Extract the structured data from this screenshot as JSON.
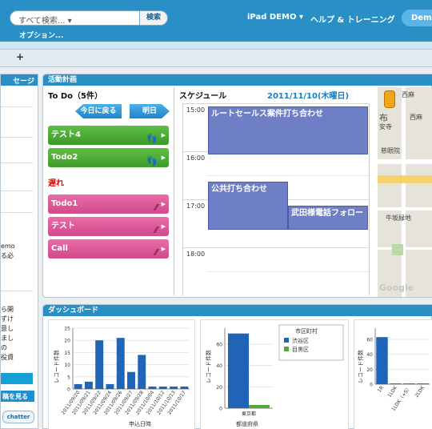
{
  "header": {
    "search_placeholder": "すべて検索... ▾",
    "search_button": "検索",
    "options_link": "オプション...",
    "app_menu": "iPad DEMO",
    "help_link": "ヘルプ & トレーニング",
    "user_menu": "Demo"
  },
  "toolbar": {
    "add_icon": "+"
  },
  "left_panel": {
    "title": "セージ",
    "items": [
      "emo",
      "る必"
    ],
    "lower_items": [
      "ら開",
      "ずけ",
      "意し",
      "まし",
      "の",
      "役資"
    ],
    "button_label": "稿を見る",
    "chatter_logo": "chatter"
  },
  "activity": {
    "title": "活動計画",
    "todo": {
      "heading": "To Do（5件）",
      "today_button": "今日に戻る",
      "tomorrow_button": "明日",
      "current_items": [
        "テスト4",
        "Todo2"
      ],
      "overdue_label": "遅れ",
      "overdue_items": [
        "Todo1",
        "テスト",
        "Call"
      ]
    },
    "schedule": {
      "heading": "スケジュール",
      "date": "2011/11/10(木曜日)",
      "times": [
        "15:00",
        "16:00",
        "17:00",
        "18:00"
      ],
      "events": [
        "ルートセールス案件打ち合わせ",
        "公共打ち合わせ",
        "武田様電話フォロー"
      ]
    },
    "map": {
      "labels": [
        "布",
        "安寺",
        "西麻",
        "西麻",
        "慈眼院",
        "牛坂緑地"
      ],
      "watermark": "Google"
    }
  },
  "dashboard": {
    "title": "ダッシュボード",
    "chart1": {
      "ylabel": "レコード件数",
      "xlabel": "申込日時"
    },
    "chart2": {
      "ylabel": "レコード件数",
      "xlabel": "都道府県",
      "legend_title": "市区町村"
    },
    "chart3": {
      "ylabel": "レコード件数"
    }
  },
  "chart_data": [
    {
      "type": "bar",
      "categories": [
        "2011/09/20",
        "2011/09/21",
        "2011/09/22",
        "2011/09/24",
        "2011/09/26",
        "2011/09/27",
        "2011/09/28",
        "2011/10/04",
        "2011/10/12",
        "2011/10/13",
        "2011/10/17"
      ],
      "values": [
        2,
        3,
        20,
        2,
        21,
        7,
        14,
        1,
        1,
        1,
        1
      ],
      "yticks": [
        0,
        5,
        10,
        15,
        20,
        25
      ],
      "ylim": [
        0,
        25
      ],
      "xlabel": "申込日時",
      "ylabel": "レコード件数",
      "color": "#1f64b7"
    },
    {
      "type": "bar",
      "categories": [
        "東京都"
      ],
      "series": [
        {
          "name": "渋谷区",
          "values": [
            70
          ],
          "color": "#1f64b7"
        },
        {
          "name": "目黒区",
          "values": [
            3
          ],
          "color": "#54a636"
        }
      ],
      "yticks": [
        0,
        20,
        40,
        60
      ],
      "ylim": [
        0,
        75
      ],
      "xlabel": "都道府県",
      "ylabel": "レコード件数",
      "legend_title": "市区町村"
    },
    {
      "type": "bar",
      "categories": [
        "1R",
        "1LDK",
        "1LDK（+S）",
        "2LDK"
      ],
      "values": [
        63,
        1,
        1,
        1
      ],
      "yticks": [
        0,
        20,
        40,
        60
      ],
      "ylim": [
        0,
        75
      ],
      "ylabel": "レコード件数",
      "color": "#1f64b7"
    }
  ]
}
